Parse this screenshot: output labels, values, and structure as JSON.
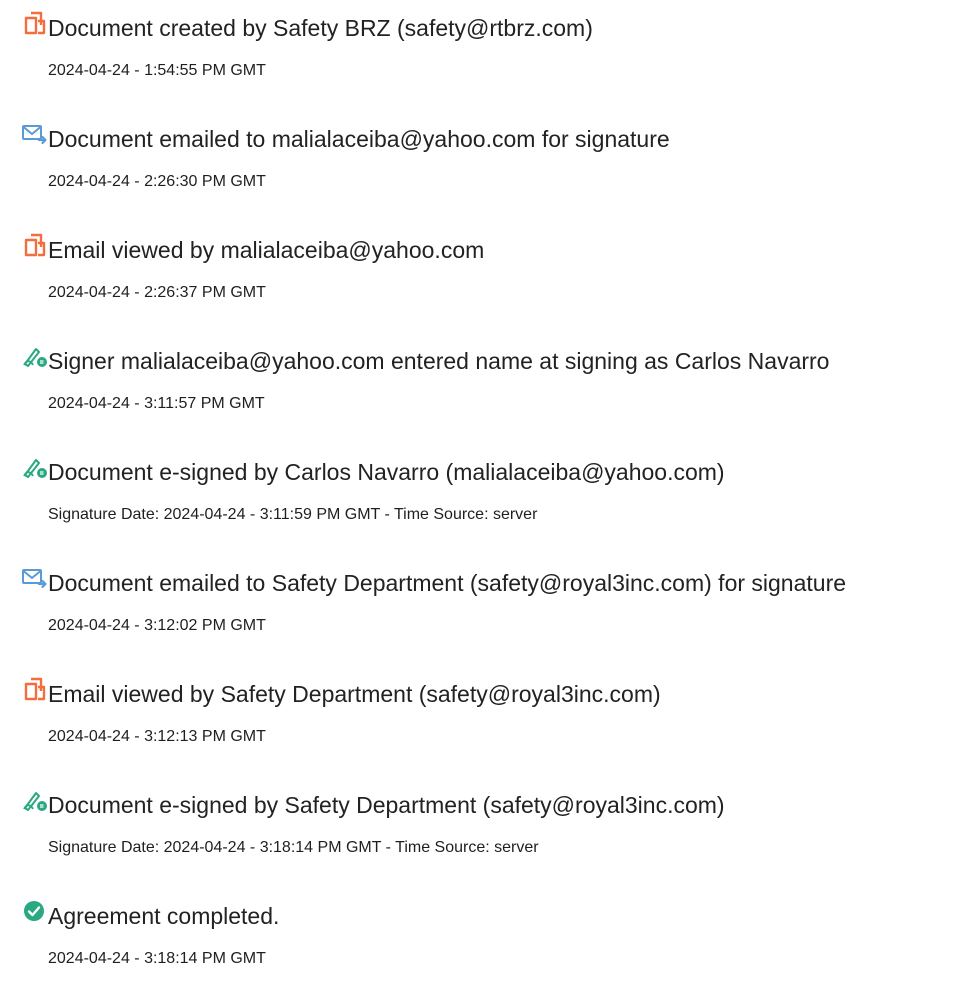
{
  "events": [
    {
      "icon": "document-icon",
      "title": "Document created by Safety BRZ (safety@rtbrz.com)",
      "time": "2024-04-24 - 1:54:55 PM GMT"
    },
    {
      "icon": "email-sent-icon",
      "title": "Document emailed to malialaceiba@yahoo.com for signature",
      "time": "2024-04-24 - 2:26:30 PM GMT"
    },
    {
      "icon": "document-icon",
      "title": "Email viewed by malialaceiba@yahoo.com",
      "time": "2024-04-24 - 2:26:37 PM GMT"
    },
    {
      "icon": "signature-icon",
      "title": "Signer malialaceiba@yahoo.com entered name at signing as Carlos Navarro",
      "time": "2024-04-24 - 3:11:57 PM GMT"
    },
    {
      "icon": "signature-icon",
      "title": "Document e-signed by Carlos Navarro (malialaceiba@yahoo.com)",
      "time": "Signature Date: 2024-04-24 - 3:11:59 PM GMT - Time Source: server"
    },
    {
      "icon": "email-sent-icon",
      "title": "Document emailed to Safety Department (safety@royal3inc.com) for signature",
      "time": "2024-04-24 - 3:12:02 PM GMT"
    },
    {
      "icon": "document-icon",
      "title": "Email viewed by Safety Department (safety@royal3inc.com)",
      "time": "2024-04-24 - 3:12:13 PM GMT"
    },
    {
      "icon": "signature-icon",
      "title": "Document e-signed by Safety Department (safety@royal3inc.com)",
      "time": "Signature Date: 2024-04-24 - 3:18:14 PM GMT - Time Source: server"
    },
    {
      "icon": "check-circle-icon",
      "title": "Agreement completed.",
      "time": "2024-04-24 - 3:18:14 PM GMT"
    }
  ],
  "colors": {
    "document_icon": "#f26e3d",
    "email_icon": "#5b9bd5",
    "signature_icon": "#2aa882",
    "check_icon": "#2aa882"
  }
}
